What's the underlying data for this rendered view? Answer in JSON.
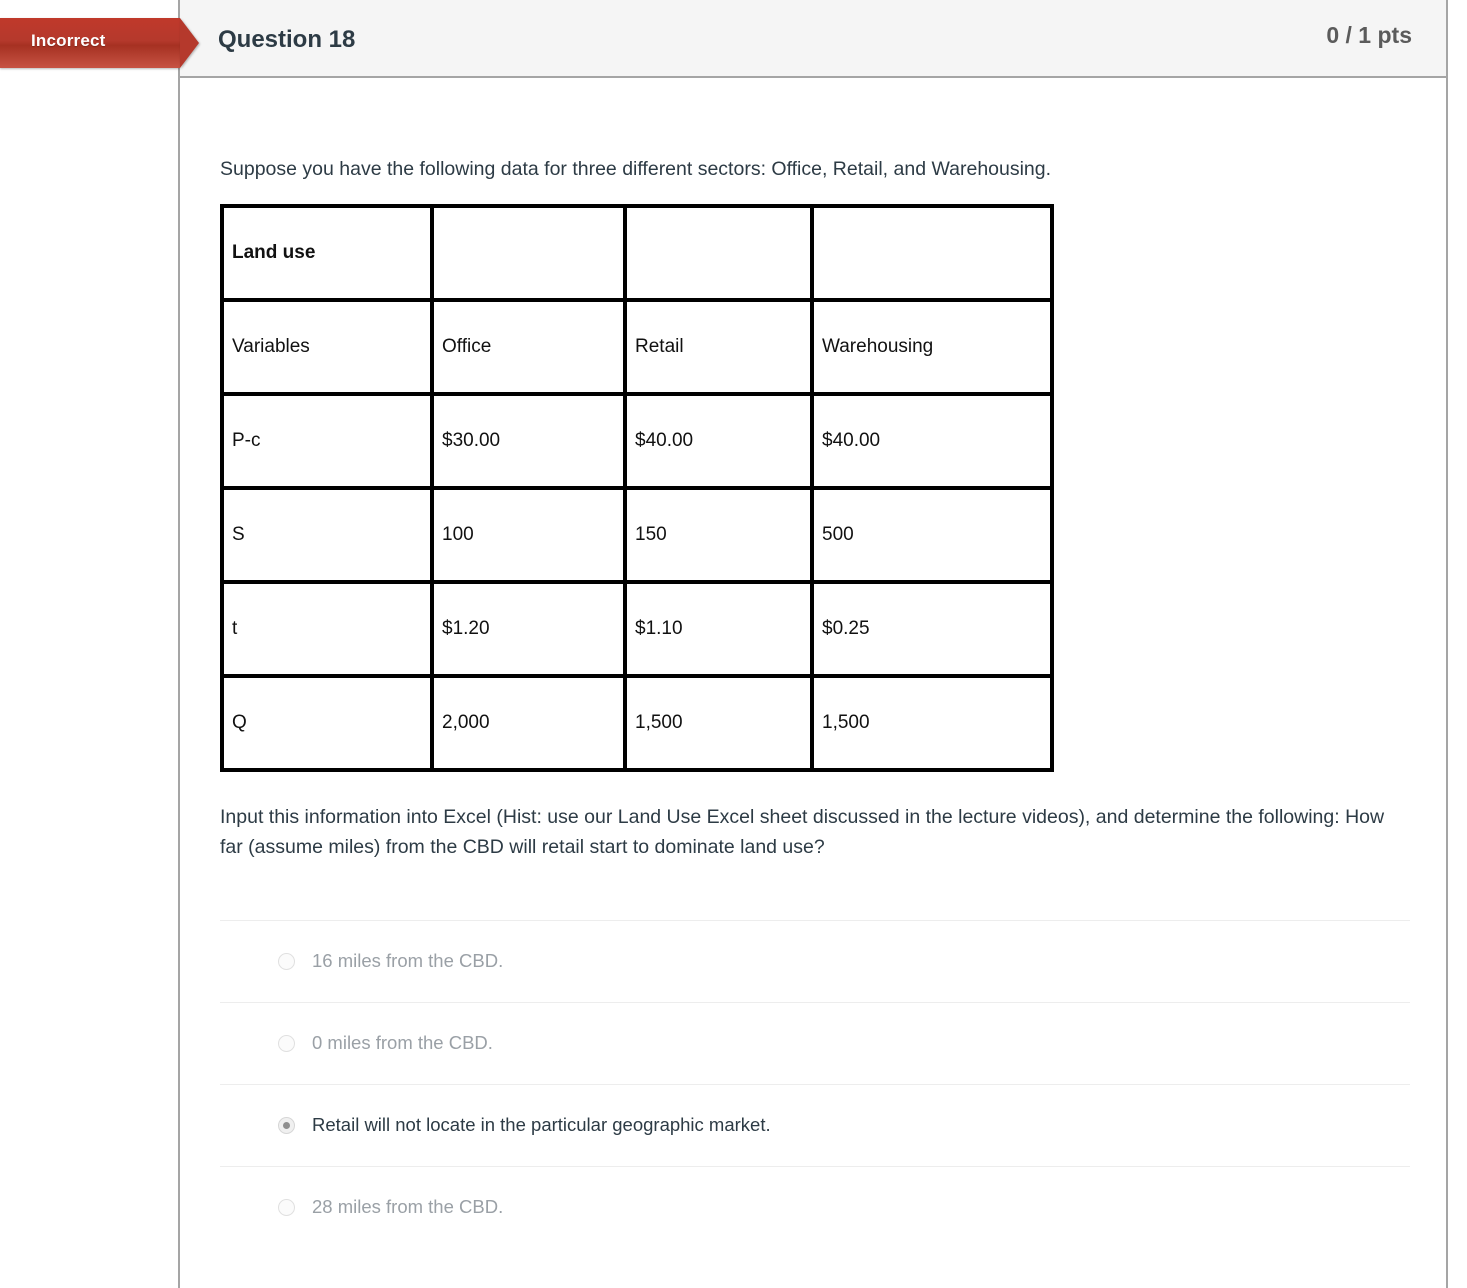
{
  "header": {
    "status_flag": "Incorrect",
    "title": "Question 18",
    "points": "0 / 1 pts",
    "flag_color": "#b5392c"
  },
  "body": {
    "intro_text": "Suppose you have the following data for three different sectors: Office, Retail, and Warehousing.",
    "outro_text": "Input this information into Excel (Hist: use our Land Use Excel sheet discussed in the lecture videos), and determine the following: How far (assume miles) from the CBD will retail start to dominate land use?"
  },
  "table": {
    "rows": [
      {
        "cells": [
          "Land use",
          "",
          "",
          ""
        ],
        "bold": true
      },
      {
        "cells": [
          "Variables",
          "Office",
          "Retail",
          "Warehousing"
        ],
        "bold": false
      },
      {
        "cells": [
          "P-c",
          "$30.00",
          "$40.00",
          "$40.00"
        ],
        "bold": false
      },
      {
        "cells": [
          "S",
          "100",
          "150",
          "500"
        ],
        "bold": false
      },
      {
        "cells": [
          "t",
          "$1.20",
          "$1.10",
          "$0.25"
        ],
        "bold": false
      },
      {
        "cells": [
          "Q",
          "2,000",
          "1,500",
          "1,500"
        ],
        "bold": false
      }
    ]
  },
  "answers": [
    {
      "label": "16 miles from the CBD.",
      "selected": false
    },
    {
      "label": "0 miles from the CBD.",
      "selected": false
    },
    {
      "label": "Retail will not locate in the particular geographic market.",
      "selected": true
    },
    {
      "label": "28 miles from the CBD.",
      "selected": false
    }
  ]
}
